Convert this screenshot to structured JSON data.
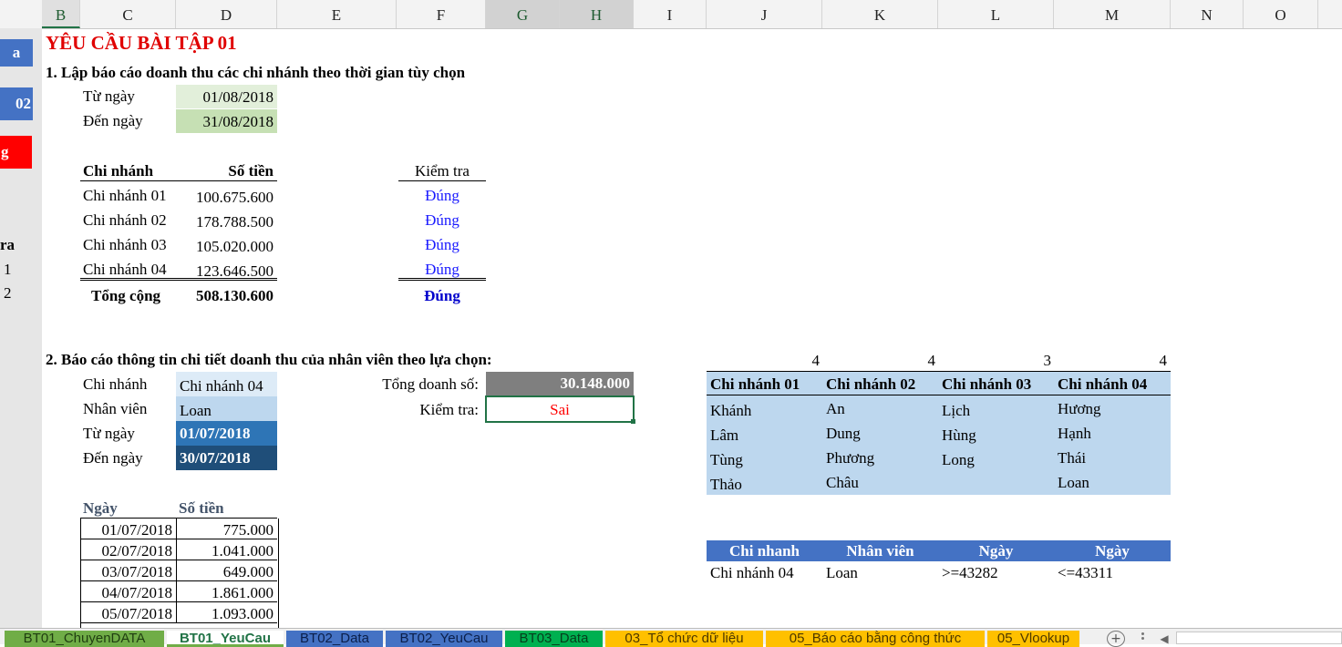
{
  "columns": [
    "B",
    "C",
    "D",
    "E",
    "F",
    "G",
    "H",
    "I",
    "J",
    "K",
    "L",
    "M",
    "N",
    "O"
  ],
  "left_partial": {
    "a": "a",
    "b": "02",
    "c": "g",
    "d": "ra",
    "e": "1",
    "f": "2"
  },
  "title": "YÊU CẦU BÀI TẬP 01",
  "section1": {
    "heading": "1. Lập báo cáo doanh thu các chi nhánh theo thời gian tùy chọn",
    "from_label": "Từ ngày",
    "from_value": "01/08/2018",
    "to_label": "Đến ngày",
    "to_value": "31/08/2018",
    "col_branch": "Chi nhánh",
    "col_amount": "Số tiền",
    "col_check": "Kiểm tra",
    "rows": [
      {
        "branch": "Chi nhánh 01",
        "amount": "100.675.600",
        "check": "Đúng"
      },
      {
        "branch": "Chi nhánh 02",
        "amount": "178.788.500",
        "check": "Đúng"
      },
      {
        "branch": "Chi nhánh 03",
        "amount": "105.020.000",
        "check": "Đúng"
      },
      {
        "branch": "Chi nhánh 04",
        "amount": "123.646.500",
        "check": "Đúng"
      }
    ],
    "total_label": "Tổng cộng",
    "total_amount": "508.130.600",
    "total_check": "Đúng"
  },
  "section2": {
    "heading": "2. Báo cáo thông tin chi tiết doanh thu của nhân viên theo lựa chọn:",
    "branch_label": "Chi nhánh",
    "branch_value": "Chi nhánh 04",
    "staff_label": "Nhân viên",
    "staff_value": "Loan",
    "from_label": "Từ ngày",
    "from_value": "01/07/2018",
    "to_label": "Đến ngày",
    "to_value": "30/07/2018",
    "sales_label": "Tổng doanh số:",
    "sales_value": "30.148.000",
    "check_label": "Kiểm tra:",
    "check_value": "Sai",
    "date_col": "Ngày",
    "amount_col": "Số tiền",
    "rows": [
      {
        "date": "01/07/2018",
        "amount": "775.000"
      },
      {
        "date": "02/07/2018",
        "amount": "1.041.000"
      },
      {
        "date": "03/07/2018",
        "amount": "649.000"
      },
      {
        "date": "04/07/2018",
        "amount": "1.861.000"
      },
      {
        "date": "05/07/2018",
        "amount": "1.093.000"
      }
    ]
  },
  "branch_table": {
    "counts": [
      "4",
      "4",
      "3",
      "4"
    ],
    "headers": [
      "Chi nhánh 01",
      "Chi nhánh 02",
      "Chi nhánh 03",
      "Chi nhánh 04"
    ],
    "rows": [
      [
        "Khánh",
        "An",
        "Lịch",
        "Hương"
      ],
      [
        "Lâm",
        "Dung",
        "Hùng",
        "Hạnh"
      ],
      [
        "Tùng",
        "Phương",
        "Long",
        "Thái"
      ],
      [
        "Thảo",
        "Châu",
        "",
        "Loan"
      ]
    ]
  },
  "criteria": {
    "headers": [
      "Chi nhanh",
      "Nhân viên",
      "Ngày",
      "Ngày"
    ],
    "values": [
      "Chi nhánh 04",
      "Loan",
      ">=43282",
      "<=43311"
    ]
  },
  "sheet_tabs": [
    {
      "label": "BT01_ChuyenDATA",
      "color": "#70ad47"
    },
    {
      "label": "BT01_YeuCau",
      "color": "#ffffff"
    },
    {
      "label": "BT02_Data",
      "color": "#4472c4"
    },
    {
      "label": "BT02_YeuCau",
      "color": "#4472c4"
    },
    {
      "label": "BT03_Data",
      "color": "#00b050"
    },
    {
      "label": "03_Tổ chức dữ liệu",
      "color": "#ffc000"
    },
    {
      "label": "05_Báo cáo bằng công thức",
      "color": "#ffc000"
    },
    {
      "label": "05_Vlookup",
      "color": "#ffc000"
    }
  ],
  "add_sheet": "+"
}
